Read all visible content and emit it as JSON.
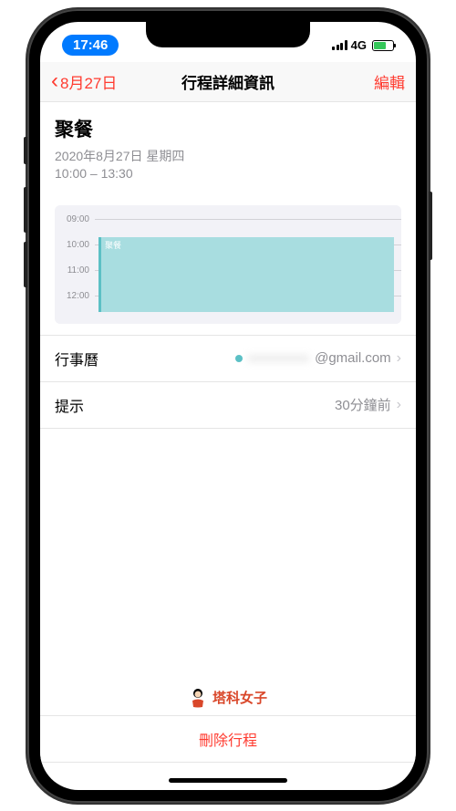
{
  "status_bar": {
    "time": "17:46",
    "network": "4G"
  },
  "nav": {
    "back_label": "8月27日",
    "title": "行程詳細資訊",
    "edit_label": "編輯"
  },
  "event": {
    "title": "聚餐",
    "date_text": "2020年8月27日 星期四",
    "time_text": "10:00 – 13:30"
  },
  "timeline": {
    "hours": [
      "09:00",
      "10:00",
      "11:00",
      "12:00"
    ],
    "block_label": "聚餐"
  },
  "rows": {
    "calendar": {
      "label": "行事曆",
      "value_suffix": "@gmail.com",
      "value_hidden": "xxxxxxxxx"
    },
    "alert": {
      "label": "提示",
      "value": "30分鐘前"
    }
  },
  "watermark": {
    "text": "塔科女子"
  },
  "delete": {
    "label": "刪除行程"
  }
}
